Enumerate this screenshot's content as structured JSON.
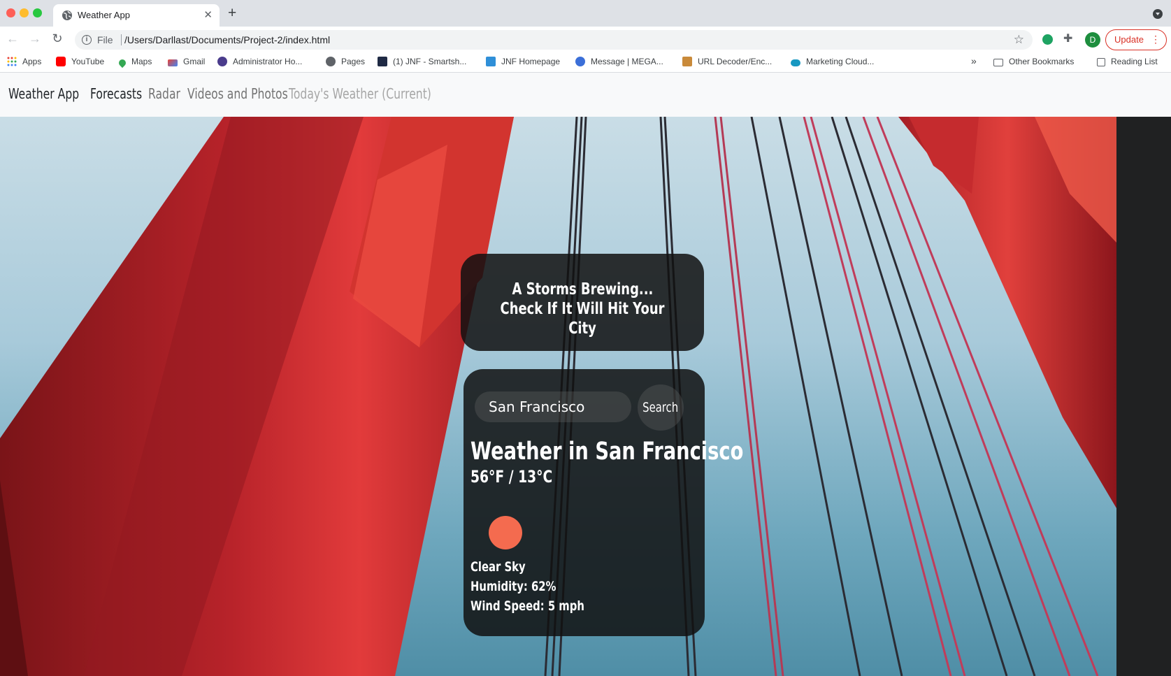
{
  "browser": {
    "tab_title": "Weather App",
    "new_tab_symbol": "+",
    "close_symbol": "✕",
    "address_scheme": "File",
    "url": "/Users/Darllast/Documents/Project-2/index.html",
    "avatar_letter": "D",
    "update_label": "Update",
    "bookmarks": [
      {
        "label": "Apps",
        "icon": "apps-grid-icon"
      },
      {
        "label": "YouTube",
        "icon": "youtube-icon"
      },
      {
        "label": "Maps",
        "icon": "maps-icon"
      },
      {
        "label": "Gmail",
        "icon": "gmail-icon"
      },
      {
        "label": "Administrator Ho...",
        "icon": "admin-icon"
      },
      {
        "label": "Pages",
        "icon": "globe-icon"
      },
      {
        "label": "(1) JNF - Smartsh...",
        "icon": "smartsheet-icon"
      },
      {
        "label": "JNF Homepage",
        "icon": "jnf-icon"
      },
      {
        "label": "Message | MEGA...",
        "icon": "mega-icon"
      },
      {
        "label": "URL Decoder/Enc...",
        "icon": "decoder-icon"
      },
      {
        "label": "Marketing Cloud...",
        "icon": "cloud-icon"
      }
    ],
    "more_bookmarks": "»",
    "other_bookmarks": "Other Bookmarks",
    "reading_list": "Reading List"
  },
  "app": {
    "brand": "Weather App",
    "nav": [
      "Forecasts",
      "Radar",
      "Videos and Photos",
      "Today's Weather (Current)"
    ],
    "headline_line1": "A Storms Brewing...",
    "headline_line2": "Check If It Will Hit Your City",
    "search": {
      "value": "San Francisco",
      "button_label": "Search"
    },
    "weather": {
      "title": "Weather in San Francisco",
      "temperature": "56°F / 13°C",
      "icon": "sun-icon",
      "description": "Clear Sky",
      "humidity": "Humidity: 62%",
      "wind": "Wind Speed: 5 mph"
    }
  },
  "colors": {
    "accent_sun": "#f46b4f",
    "bridge_red": "#c0262a",
    "update_red": "#d93025",
    "navbar_bg": "#f8f9fa"
  }
}
